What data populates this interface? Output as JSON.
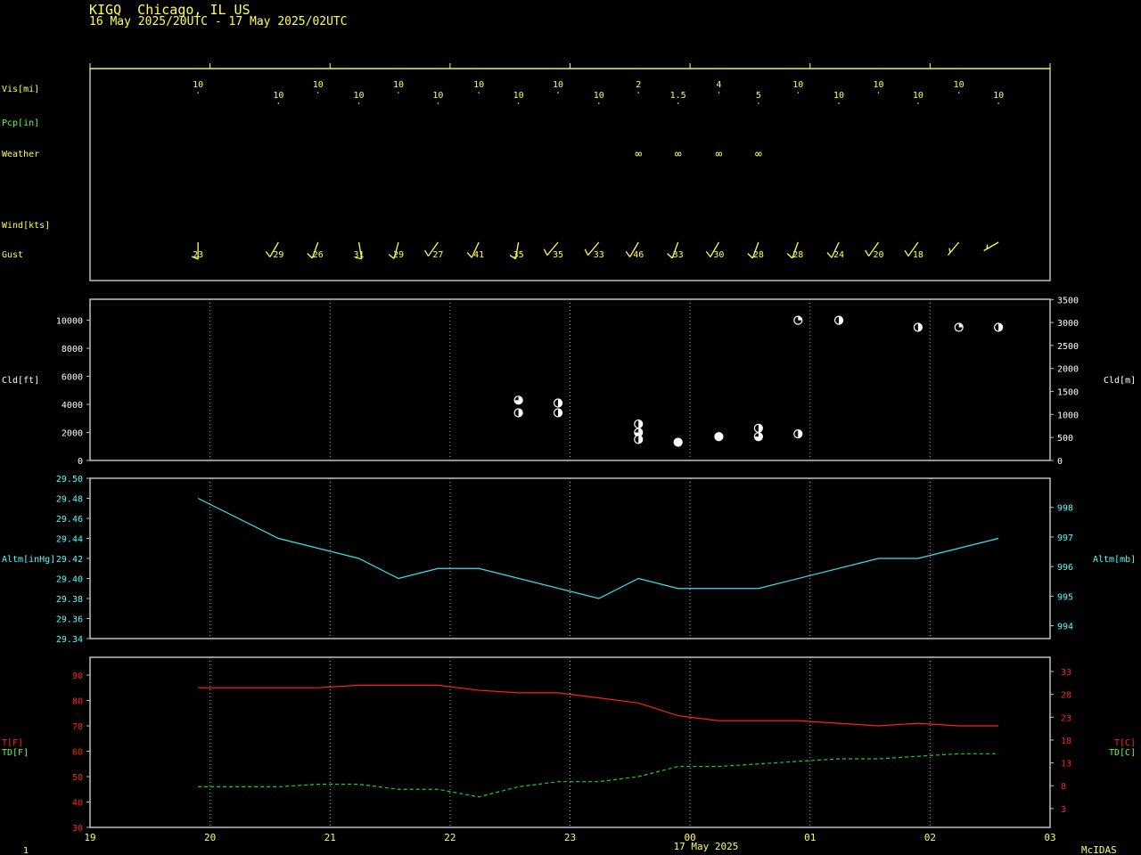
{
  "header": {
    "station": "KIGQ  Chicago, IL US",
    "period": "16 May 2025/20UTC - 17 May 2025/02UTC"
  },
  "footer": {
    "page": "1",
    "date": "17 May 2025",
    "brand": "McIDAS"
  },
  "colors": {
    "background": "#000000",
    "frame": "#c0c0c0",
    "text_yellow": "#ffff55",
    "text_green": "#55ff55",
    "text_cyan": "#55ffff",
    "text_red": "#ff2020",
    "temp_line": "#ff2020",
    "dewpoint_line": "#20d020",
    "altimeter_line": "#40e0f0",
    "cloud_symbol": "#ffffff"
  },
  "time_axis": {
    "tick_labels": [
      "19",
      "20",
      "21",
      "22",
      "23",
      "00",
      "01",
      "02",
      "03"
    ],
    "range_hours": [
      19,
      27
    ]
  },
  "obs_times": [
    19.9,
    20.57,
    20.9,
    21.24,
    21.57,
    21.9,
    22.24,
    22.57,
    22.9,
    23.24,
    23.57,
    23.9,
    24.24,
    24.57,
    24.9,
    25.24,
    25.57,
    25.9,
    26.24,
    26.57
  ],
  "chart_data": [
    {
      "type": "table",
      "name": "surface",
      "row_labels": {
        "vis": "Vis[mi]",
        "pcp": "Pcp[in]",
        "weather": "Weather",
        "wind": "Wind[kts]",
        "gust": "Gust"
      },
      "visibility": [
        "10",
        "10",
        "10",
        "10",
        "10",
        "10",
        "10",
        "10",
        "10",
        "10",
        "2",
        "1.5",
        "4",
        "5",
        "10",
        "10",
        "10",
        "10",
        "10",
        "10"
      ],
      "weather_symbols": [
        {
          "x": 23.57,
          "symbol": "∞"
        },
        {
          "x": 23.9,
          "symbol": "∞"
        },
        {
          "x": 24.24,
          "symbol": "∞"
        },
        {
          "x": 24.57,
          "symbol": "∞"
        }
      ],
      "wind_barbs": [
        {
          "x": 19.9,
          "dir_deg": 180,
          "speed_kts": 10
        },
        {
          "x": 20.57,
          "dir_deg": 210,
          "speed_kts": 10
        },
        {
          "x": 20.9,
          "dir_deg": 200,
          "speed_kts": 10
        },
        {
          "x": 21.24,
          "dir_deg": 170,
          "speed_kts": 10
        },
        {
          "x": 21.57,
          "dir_deg": 195,
          "speed_kts": 10
        },
        {
          "x": 21.9,
          "dir_deg": 215,
          "speed_kts": 10
        },
        {
          "x": 22.24,
          "dir_deg": 205,
          "speed_kts": 10
        },
        {
          "x": 22.57,
          "dir_deg": 190,
          "speed_kts": 10
        },
        {
          "x": 22.9,
          "dir_deg": 220,
          "speed_kts": 10
        },
        {
          "x": 23.24,
          "dir_deg": 220,
          "speed_kts": 10
        },
        {
          "x": 23.57,
          "dir_deg": 210,
          "speed_kts": 10
        },
        {
          "x": 23.9,
          "dir_deg": 200,
          "speed_kts": 10
        },
        {
          "x": 24.24,
          "dir_deg": 210,
          "speed_kts": 10
        },
        {
          "x": 24.57,
          "dir_deg": 200,
          "speed_kts": 10
        },
        {
          "x": 24.9,
          "dir_deg": 200,
          "speed_kts": 10
        },
        {
          "x": 25.24,
          "dir_deg": 205,
          "speed_kts": 10
        },
        {
          "x": 25.57,
          "dir_deg": 215,
          "speed_kts": 10
        },
        {
          "x": 25.9,
          "dir_deg": 215,
          "speed_kts": 10
        },
        {
          "x": 26.24,
          "dir_deg": 220,
          "speed_kts": 5
        },
        {
          "x": 26.57,
          "dir_deg": 240,
          "speed_kts": 5
        }
      ],
      "gusts": [
        "23",
        "29",
        "26",
        "31",
        "29",
        "27",
        "41",
        "35",
        "35",
        "33",
        "46",
        "33",
        "30",
        "28",
        "28",
        "24",
        "20",
        "18"
      ]
    },
    {
      "type": "scatter",
      "name": "clouds",
      "ylabel": "Cld[ft]",
      "ylabel_right": "Cld[m]",
      "ylim": [
        0,
        11500
      ],
      "yticks": [
        0,
        2000,
        4000,
        6000,
        8000,
        10000
      ],
      "yticks_right": [
        0,
        500,
        1000,
        1500,
        2000,
        2500,
        3000,
        3500
      ],
      "points": [
        {
          "x": 22.57,
          "y": 4300,
          "cover": "BKN"
        },
        {
          "x": 22.57,
          "y": 3400,
          "cover": "SCT"
        },
        {
          "x": 22.9,
          "y": 4100,
          "cover": "SCT"
        },
        {
          "x": 22.9,
          "y": 3400,
          "cover": "SCT"
        },
        {
          "x": 23.57,
          "y": 2600,
          "cover": "SCT"
        },
        {
          "x": 23.57,
          "y": 2000,
          "cover": "BKN"
        },
        {
          "x": 23.57,
          "y": 1500,
          "cover": "SCT"
        },
        {
          "x": 23.9,
          "y": 1300,
          "cover": "OVC"
        },
        {
          "x": 24.24,
          "y": 1700,
          "cover": "OVC"
        },
        {
          "x": 24.57,
          "y": 2300,
          "cover": "SCT"
        },
        {
          "x": 24.57,
          "y": 1700,
          "cover": "BKN"
        },
        {
          "x": 24.9,
          "y": 1900,
          "cover": "SCT"
        },
        {
          "x": 24.9,
          "y": 10000,
          "cover": "FEW"
        },
        {
          "x": 25.24,
          "y": 10000,
          "cover": "SCT"
        },
        {
          "x": 25.9,
          "y": 9500,
          "cover": "SCT"
        },
        {
          "x": 26.24,
          "y": 9500,
          "cover": "FEW"
        },
        {
          "x": 26.57,
          "y": 9500,
          "cover": "SCT"
        }
      ]
    },
    {
      "type": "line",
      "name": "altimeter",
      "ylabel": "Altm[inHg]",
      "ylabel_right": "Altm[mb]",
      "ylim": [
        29.34,
        29.5
      ],
      "yticks": [
        "29.34",
        "29.36",
        "29.38",
        "29.40",
        "29.42",
        "29.44",
        "29.46",
        "29.48",
        "29.50"
      ],
      "yticks_right": [
        "994",
        "995",
        "996",
        "997",
        "998"
      ],
      "x": [
        19.9,
        20.57,
        21.24,
        21.57,
        21.9,
        22.24,
        23.24,
        23.57,
        23.9,
        24.57,
        25.57,
        25.9,
        26.57
      ],
      "values": [
        29.48,
        29.44,
        29.42,
        29.4,
        29.41,
        29.41,
        29.38,
        29.4,
        29.39,
        29.39,
        29.42,
        29.42,
        29.44
      ]
    },
    {
      "type": "line",
      "name": "temperature",
      "ylabel": "T[F]",
      "ylabel2": "TD[F]",
      "ylabel_right": "T[C]",
      "ylabel_right2": "TD[C]",
      "ylim": [
        30,
        97
      ],
      "yticks": [
        "30",
        "40",
        "50",
        "60",
        "70",
        "80",
        "90"
      ],
      "yticks_right": [
        "3",
        "8",
        "13",
        "18",
        "23",
        "28",
        "33"
      ],
      "series": [
        {
          "key": "T",
          "x": [
            19.9,
            20.57,
            20.9,
            21.24,
            21.57,
            21.9,
            22.24,
            22.57,
            22.9,
            23.24,
            23.57,
            23.9,
            24.24,
            24.57,
            24.9,
            25.24,
            25.57,
            25.9,
            26.24,
            26.57
          ],
          "values": [
            85,
            85,
            85,
            86,
            86,
            86,
            84,
            83,
            83,
            81,
            79,
            74,
            72,
            72,
            72,
            71,
            70,
            71,
            70,
            70
          ]
        },
        {
          "key": "TD",
          "x": [
            19.9,
            20.57,
            20.9,
            21.24,
            21.57,
            21.9,
            22.24,
            22.57,
            22.9,
            23.24,
            23.57,
            23.9,
            24.24,
            24.57,
            24.9,
            25.24,
            25.57,
            25.9,
            26.24,
            26.57
          ],
          "values": [
            46,
            46,
            47,
            47,
            45,
            45,
            42,
            46,
            48,
            48,
            50,
            54,
            54,
            55,
            56,
            57,
            57,
            58,
            59,
            59
          ]
        }
      ]
    }
  ]
}
